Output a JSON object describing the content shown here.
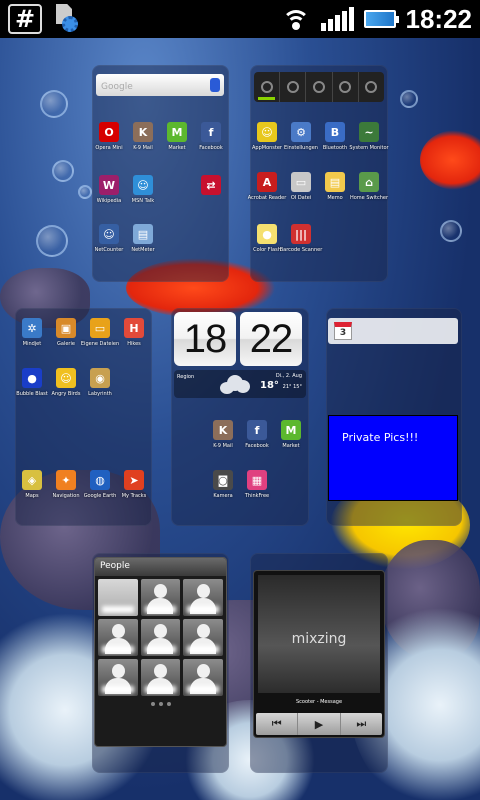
{
  "status_bar": {
    "hash_icon": "#",
    "time": "18:22"
  },
  "search": {
    "placeholder": "Google"
  },
  "panel1_apps": [
    {
      "label": "Opera Mini",
      "color": "#d60000",
      "glyph": "O"
    },
    {
      "label": "K-9 Mail",
      "color": "#8c6e5a",
      "glyph": "K"
    },
    {
      "label": "Market",
      "color": "#5cb82e",
      "glyph": "M"
    },
    {
      "label": "Facebook",
      "color": "#3b5998",
      "glyph": "f"
    },
    {
      "label": "Wikipedia",
      "color": "#9c1f6a",
      "glyph": "W"
    },
    {
      "label": "MSN Talk",
      "color": "#2f8fd8",
      "glyph": "☺"
    },
    {
      "label": "",
      "color": "#c8102e",
      "glyph": "⇄"
    },
    {
      "label": "NetCounter",
      "color": "#365fa3",
      "glyph": "☺"
    },
    {
      "label": "NetMeter",
      "color": "#7fa9d8",
      "glyph": "▤"
    }
  ],
  "panel2_apps": [
    {
      "label": "AppMonster",
      "color": "#e8c81c",
      "glyph": "☺"
    },
    {
      "label": "Einstellungen",
      "color": "#4a7ac7",
      "glyph": "⚙"
    },
    {
      "label": "Bluetooth",
      "color": "#3a6cc5",
      "glyph": "B"
    },
    {
      "label": "System Monitor",
      "color": "#3c7a3a",
      "glyph": "~"
    },
    {
      "label": "Acrobat Reader",
      "color": "#c81e1e",
      "glyph": "A"
    },
    {
      "label": "OI Datei",
      "color": "#c8c8c8",
      "glyph": "▭"
    },
    {
      "label": "Memo",
      "color": "#f2c94c",
      "glyph": "▤"
    },
    {
      "label": "Home Switcher",
      "color": "#5a9a4a",
      "glyph": "⌂"
    },
    {
      "label": "Color Flash",
      "color": "#f5e070",
      "glyph": "●"
    },
    {
      "label": "Barcode Scanner",
      "color": "#d03030",
      "glyph": "|||"
    }
  ],
  "panel3_apps": [
    {
      "label": "Mindjet",
      "color": "#3a7ac8",
      "glyph": "✲"
    },
    {
      "label": "Galerie",
      "color": "#d88a2a",
      "glyph": "▣"
    },
    {
      "label": "Eigene Dateien",
      "color": "#e8a21a",
      "glyph": "▭"
    },
    {
      "label": "Hikes",
      "color": "#e24a3a",
      "glyph": "H"
    },
    {
      "label": "Bubble Blast",
      "color": "#1a3ec8",
      "glyph": "●"
    },
    {
      "label": "Angry Birds",
      "color": "#f0c020",
      "glyph": "☺"
    },
    {
      "label": "Labyrinth",
      "color": "#c8a050",
      "glyph": "◉"
    },
    {
      "label": "Maps",
      "color": "#d8c040",
      "glyph": "◈"
    },
    {
      "label": "Navigation",
      "color": "#f08020",
      "glyph": "✦"
    },
    {
      "label": "Google Earth",
      "color": "#2060c0",
      "glyph": "◍"
    },
    {
      "label": "My Tracks",
      "color": "#e04020",
      "glyph": "➤"
    }
  ],
  "panel4_apps": [
    {
      "label": "K-9 Mail",
      "color": "#8c6e5a",
      "glyph": "K"
    },
    {
      "label": "Facebook",
      "color": "#3b5998",
      "glyph": "f"
    },
    {
      "label": "Market",
      "color": "#5cb82e",
      "glyph": "M"
    },
    {
      "label": "Kamera",
      "color": "#4a4a4a",
      "glyph": "◙"
    },
    {
      "label": "ThinkFree",
      "color": "#e04080",
      "glyph": "▦"
    }
  ],
  "clock_widget": {
    "hour": "18",
    "minute": "22",
    "city": "Region",
    "date": "Di., 2. Aug",
    "temp": "18°",
    "range": "21° 15°"
  },
  "calendar": {
    "day": "3"
  },
  "private_pics": {
    "label": "Private Pics!!!",
    "color": "#0000ff"
  },
  "people": {
    "title": "People"
  },
  "music": {
    "logo": "mixzing",
    "track": "Scooter - Message",
    "prev": "⏮",
    "play": "▶",
    "next": "⏭"
  }
}
